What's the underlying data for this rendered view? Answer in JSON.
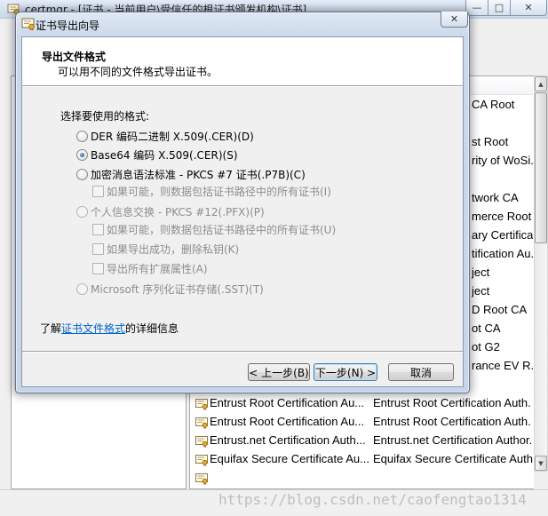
{
  "main_window": {
    "title": "certmgr - [证书 - 当前用户\\受信任的根证书颁发机构\\证书]",
    "app_icon": "certmgr-icon",
    "controls": {
      "minimize": "minimize-icon",
      "maximize": "maximize-icon",
      "close": "close-icon"
    }
  },
  "dialog": {
    "title": "证书导出向导",
    "icon": "certificate-wizard-icon",
    "close_icon": "close-icon",
    "header": {
      "title": "导出文件格式",
      "subtitle": "可以用不同的文件格式导出证书。"
    },
    "prompt": "选择要使用的格式:",
    "options": [
      {
        "label": "DER 编码二进制 X.509(.CER)(D)",
        "checked": false,
        "enabled": true
      },
      {
        "label": "Base64 编码 X.509(.CER)(S)",
        "checked": true,
        "enabled": true
      },
      {
        "label": "加密消息语法标准 - PKCS #7 证书(.P7B)(C)",
        "checked": false,
        "enabled": true
      },
      {
        "label": "如果可能，则数据包括证书路径中的所有证书(I)",
        "checked": false,
        "enabled": false
      },
      {
        "label": "个人信息交换 - PKCS #12(.PFX)(P)",
        "checked": false,
        "enabled": false
      },
      {
        "label": "如果可能，则数据包括证书路径中的所有证书(U)",
        "checked": false,
        "enabled": false
      },
      {
        "label": "如果导出成功，删除私钥(K)",
        "checked": false,
        "enabled": false
      },
      {
        "label": "导出所有扩展属性(A)",
        "checked": false,
        "enabled": false
      },
      {
        "label": "Microsoft 序列化证书存储(.SST)(T)",
        "checked": false,
        "enabled": false
      }
    ],
    "learn_more": {
      "prefix": "了解",
      "link_text": "证书文件格式",
      "suffix": "的详细信息"
    },
    "buttons": {
      "back": "< 上一步(B)",
      "next": "下一步(N) >",
      "cancel": "取消"
    },
    "colors": {
      "link": "#0066cc",
      "default_button_border": "#3c7fb1"
    }
  },
  "cert_list": {
    "row_icon": "certificate-icon",
    "issuer_tails": [
      "CA Root",
      "",
      "st Root",
      "rity of WoSi.",
      "",
      "twork CA",
      "merce Root .",
      "ary Certifica.",
      "tification Au.",
      "ject",
      "ject",
      "D Root CA",
      "ot CA",
      "ot G2",
      "rance EV R...",
      ""
    ],
    "rows": [
      {
        "name": "Entrust Root Certification Au...",
        "issuer": "Entrust Root Certification Auth."
      },
      {
        "name": "Entrust Root Certification Au...",
        "issuer": "Entrust Root Certification Auth."
      },
      {
        "name": "Entrust.net Certification Auth...",
        "issuer": "Entrust.net Certification Author."
      },
      {
        "name": "Equifax Secure Certificate Au...",
        "issuer": "Equifax Secure Certificate Auth."
      }
    ]
  },
  "watermark": "https://blog.csdn.net/caofengtao1314"
}
